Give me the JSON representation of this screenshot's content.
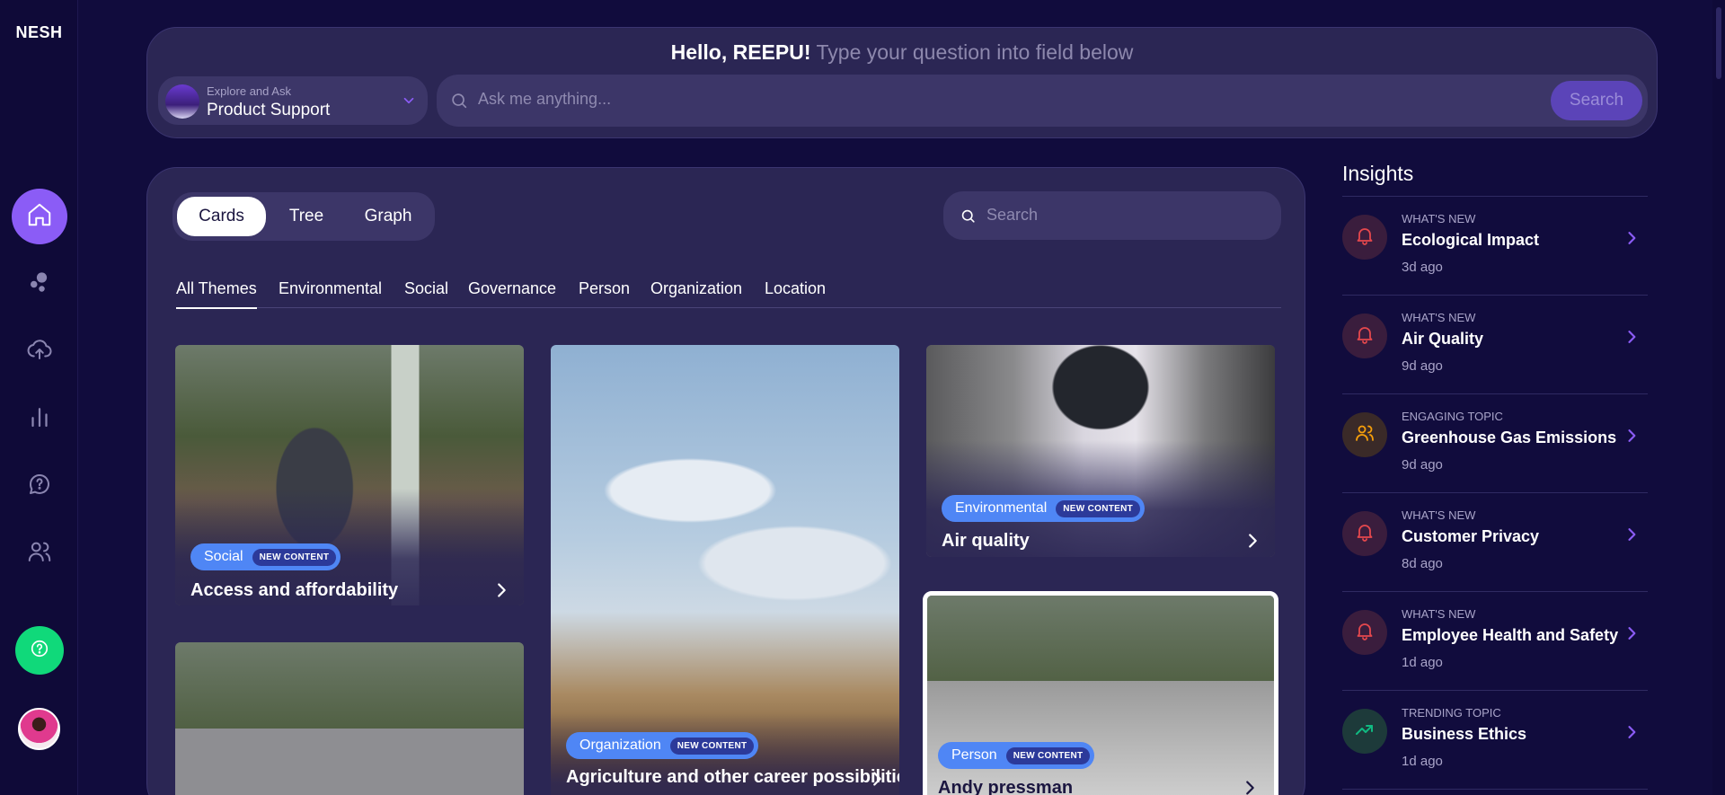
{
  "app": {
    "logo": "NESH"
  },
  "sidebar": {
    "items": [
      {
        "name": "home-icon",
        "active": true
      },
      {
        "name": "bubbles-icon",
        "active": false
      },
      {
        "name": "cloud-upload-icon",
        "active": false
      },
      {
        "name": "bar-chart-icon",
        "active": false
      },
      {
        "name": "chat-question-icon",
        "active": false
      },
      {
        "name": "users-icon",
        "active": false
      }
    ],
    "help_icon": "help-circle-icon",
    "accent": "#8b5cf6",
    "help_color": "#10d97a"
  },
  "header": {
    "greeting_name": "Hello, REEPU!",
    "greeting_hint": "Type your question into field below",
    "selector": {
      "sub_label": "Explore and Ask",
      "value": "Product Support"
    },
    "ask": {
      "placeholder": "Ask me anything...",
      "button_label": "Search"
    }
  },
  "content": {
    "view_options": [
      "Cards",
      "Tree",
      "Graph"
    ],
    "active_view": "Cards",
    "search_placeholder": "Search",
    "themes": [
      "All Themes",
      "Environmental",
      "Social",
      "Governance",
      "Person",
      "Organization",
      "Location"
    ],
    "active_theme": "All Themes",
    "cards": [
      {
        "tag": "Social",
        "badge": "NEW CONTENT",
        "title": "Access and affordability"
      },
      {
        "tag": "Organization",
        "badge": "NEW CONTENT",
        "title": "Agriculture and other career possibilities"
      },
      {
        "tag": "Environmental",
        "badge": "NEW CONTENT",
        "title": "Air quality"
      },
      {
        "tag": "Person",
        "badge": "NEW CONTENT",
        "title": "Andy pressman"
      },
      {
        "tag": "",
        "badge": "",
        "title": ""
      }
    ]
  },
  "insights": {
    "title": "Insights",
    "items": [
      {
        "kind": "WHAT'S NEW",
        "title": "Ecological Impact",
        "time": "3d ago",
        "icon": "bell-icon",
        "color": "#e5484d"
      },
      {
        "kind": "WHAT'S NEW",
        "title": "Air Quality",
        "time": "9d ago",
        "icon": "bell-icon",
        "color": "#e5484d"
      },
      {
        "kind": "ENGAGING TOPIC",
        "title": "Greenhouse Gas Emissions",
        "time": "9d ago",
        "icon": "users-icon",
        "color": "#f59e0b"
      },
      {
        "kind": "WHAT'S NEW",
        "title": "Customer Privacy",
        "time": "8d ago",
        "icon": "bell-icon",
        "color": "#e5484d"
      },
      {
        "kind": "WHAT'S NEW",
        "title": "Employee Health and Safety",
        "time": "1d ago",
        "icon": "bell-icon",
        "color": "#e5484d"
      },
      {
        "kind": "TRENDING TOPIC",
        "title": "Business Ethics",
        "time": "1d ago",
        "icon": "trend-up-icon",
        "color": "#10b981"
      }
    ]
  }
}
